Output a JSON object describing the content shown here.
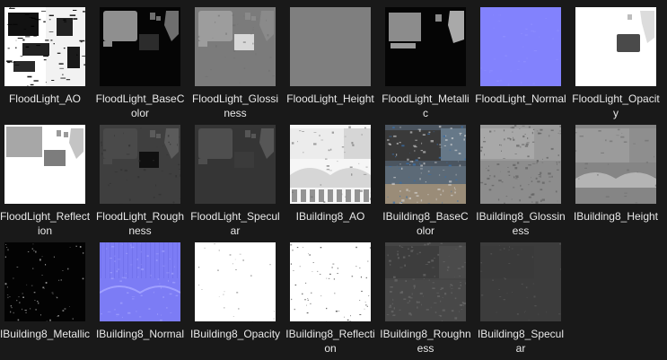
{
  "explorer": {
    "files": [
      {
        "name": "FloodLight_AO",
        "style": "fl-ao"
      },
      {
        "name": "FloodLight_BaseColor",
        "style": "fl-base"
      },
      {
        "name": "FloodLight_Glossiness",
        "style": "fl-gloss"
      },
      {
        "name": "FloodLight_Height",
        "style": "fl-height"
      },
      {
        "name": "FloodLight_Metallic",
        "style": "fl-metal"
      },
      {
        "name": "FloodLight_Normal",
        "style": "fl-normal"
      },
      {
        "name": "FloodLight_Opacity",
        "style": "fl-opacity"
      },
      {
        "name": "FloodLight_Reflection",
        "style": "fl-reflect"
      },
      {
        "name": "FloodLight_Roughness",
        "style": "fl-rough"
      },
      {
        "name": "FloodLight_Specular",
        "style": "fl-spec"
      },
      {
        "name": "IBuilding8_AO",
        "style": "ib-ao"
      },
      {
        "name": "IBuilding8_BaseColor",
        "style": "ib-base"
      },
      {
        "name": "IBuilding8_Glossiness",
        "style": "ib-gloss"
      },
      {
        "name": "IBuilding8_Height",
        "style": "ib-height"
      },
      {
        "name": "IBuilding8_Metallic",
        "style": "ib-metal"
      },
      {
        "name": "IBuilding8_Normal",
        "style": "ib-normal"
      },
      {
        "name": "IBuilding8_Opacity",
        "style": "ib-opacity"
      },
      {
        "name": "IBuilding8_Reflection",
        "style": "ib-reflect"
      },
      {
        "name": "IBuilding8_Roughness",
        "style": "ib-rough"
      },
      {
        "name": "IBuilding8_Specular",
        "style": "ib-spec"
      }
    ],
    "colors": {
      "background": "#191919",
      "label": "#e8e8e8",
      "normal_blue": "#8080ff"
    }
  }
}
